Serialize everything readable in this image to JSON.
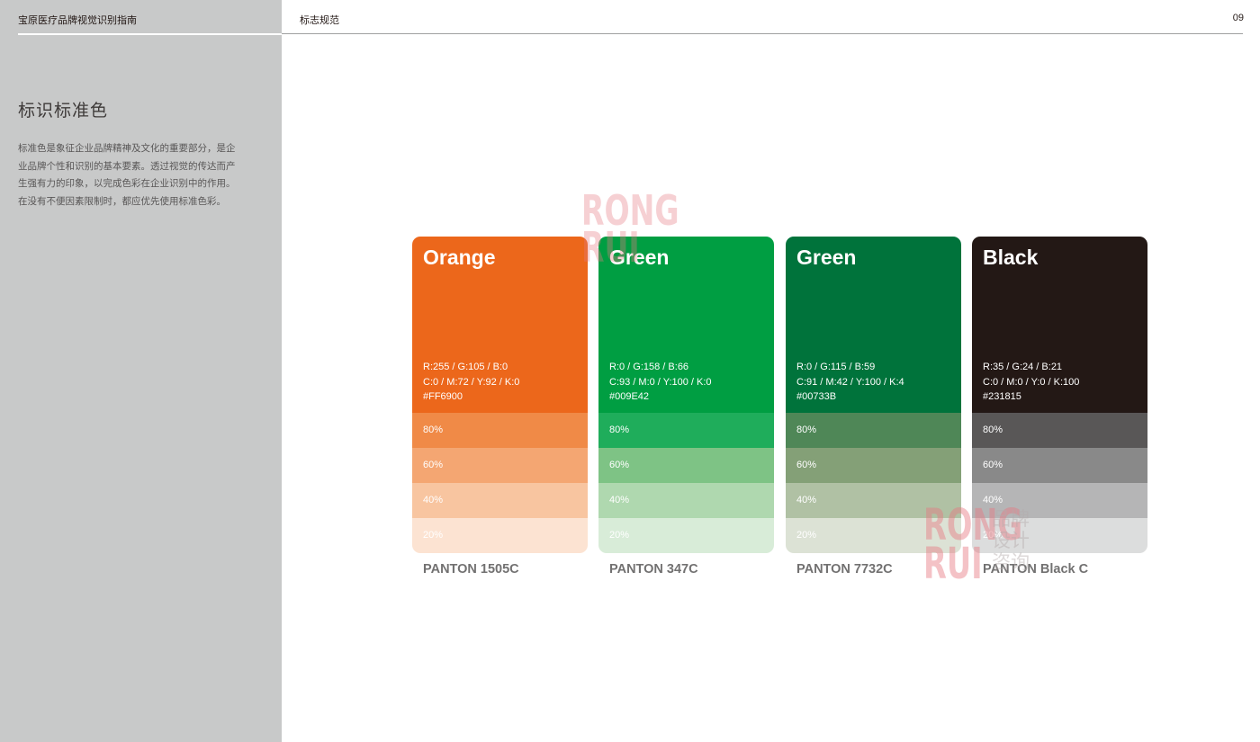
{
  "document": {
    "title": "宝原医疗品牌视觉识别指南",
    "section_label": "标志规范",
    "page_number": "09"
  },
  "sidebar": {
    "heading": "标识标准色",
    "description_lines": [
      "标准色是象征企业品牌精神及文化的重要部分，是企",
      "业品牌个性和识别的基本要素。透过视觉的传达而产",
      "生强有力的印象，以完成色彩在企业识别中的作用。",
      "在没有不便因素限制时，都应优先使用标准色彩。"
    ]
  },
  "swatches": [
    {
      "name": "Orange",
      "rgb": "R:255 / G:105 / B:0",
      "cmyk": "C:0 / M:72 / Y:92 / K:0",
      "hex": "#FF6900",
      "pantone": "PANTON 1505C",
      "colors": {
        "main": "#ec671b",
        "t80": "#f08a47",
        "t60": "#f4a672",
        "t40": "#f8c5a0",
        "t20": "#fce3d2"
      },
      "tints": [
        "80%",
        "60%",
        "40%",
        "20%"
      ]
    },
    {
      "name": "Green",
      "rgb": "R:0 / G:158 / B:66",
      "cmyk": "C:93 / M:0 / Y:100 / K:0",
      "hex": "#009E42",
      "pantone": "PANTON 347C",
      "colors": {
        "main": "#009e42",
        "t80": "#1fad5b",
        "t60": "#7ec385",
        "t40": "#afd8af",
        "t20": "#d8ecd8"
      },
      "tints": [
        "80%",
        "60%",
        "40%",
        "20%"
      ]
    },
    {
      "name": "Green",
      "rgb": "R:0 / G:115 / B:59",
      "cmyk": "C:91 / M:42 / Y:100 / K:4",
      "hex": "#00733B",
      "pantone": "PANTON 7732C",
      "colors": {
        "main": "#00733b",
        "t80": "#4f8757",
        "t60": "#84a077",
        "t40": "#b0c1a4",
        "t20": "#dce2d5"
      },
      "tints": [
        "80%",
        "60%",
        "40%",
        "20%"
      ]
    },
    {
      "name": "Black",
      "rgb": "R:35 / G:24 / B:21",
      "cmyk": "C:0 / M:0 / Y:0 / K:100",
      "hex": "#231815",
      "pantone": "PANTON Black C",
      "colors": {
        "main": "#231815",
        "t80": "#595757",
        "t60": "#898989",
        "t40": "#b5b5b6",
        "t20": "#dcdddd"
      },
      "tints": [
        "80%",
        "60%",
        "40%",
        "20%"
      ]
    }
  ],
  "watermarks": [
    {
      "lines": [
        "RONG",
        "RUI"
      ]
    },
    {
      "lines": [
        "RONG",
        "RUI"
      ],
      "cn_lines": [
        "品牌",
        "设计",
        "咨询"
      ]
    }
  ],
  "colors": {
    "sidebar_bg": "#c8c9c9",
    "text_dark": "#231815",
    "pantone_text": "#727171"
  }
}
